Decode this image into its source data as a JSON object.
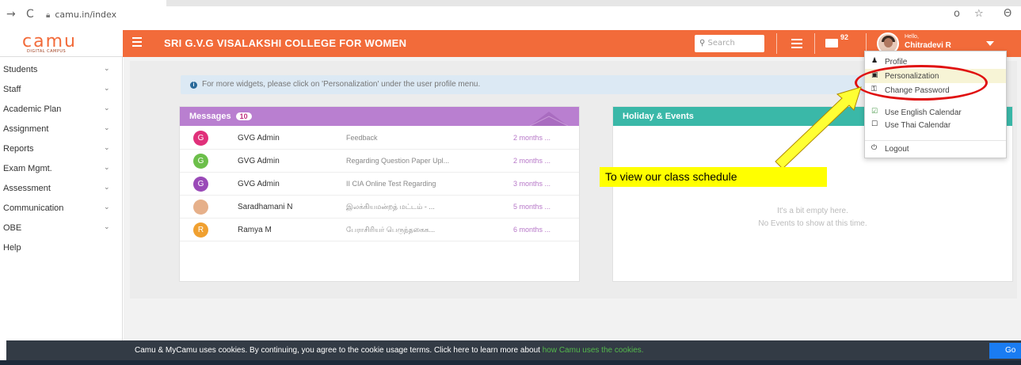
{
  "browser": {
    "back_icon": "→",
    "reload_icon": "C",
    "url": "camu.in/index",
    "key_icon": "o",
    "star_icon": "☆",
    "profile_icon": "Θ"
  },
  "logo": {
    "text": "camu",
    "subtext": "DIGITAL CAMPUS"
  },
  "header": {
    "college_name": "SRI G.V.G VISALAKSHI COLLEGE FOR WOMEN",
    "search_placeholder": "Search",
    "mail_count": "92",
    "hello": "Hello,",
    "user_name": "Chitradevi R"
  },
  "sidebar": {
    "items": [
      {
        "label": "Students",
        "chev": "⌄"
      },
      {
        "label": "Staff",
        "chev": "⌄"
      },
      {
        "label": "Academic Plan",
        "chev": "⌄"
      },
      {
        "label": "Assignment",
        "chev": "⌄"
      },
      {
        "label": "Reports",
        "chev": "⌄"
      },
      {
        "label": "Exam Mgmt.",
        "chev": "⌄"
      },
      {
        "label": "Assessment",
        "chev": "⌄"
      },
      {
        "label": "Communication",
        "chev": "⌄"
      },
      {
        "label": "OBE",
        "chev": "⌄"
      },
      {
        "label": "Help",
        "chev": ""
      }
    ]
  },
  "info": {
    "icon": "i",
    "text": "For more widgets, please click on 'Personalization' under the user profile menu."
  },
  "messages": {
    "title": "Messages",
    "badge": "10",
    "rows": [
      {
        "initial": "G",
        "color": "#e0307a",
        "sender": "GVG Admin",
        "subject": "Feedback",
        "time": "2 months ..."
      },
      {
        "initial": "G",
        "color": "#6cbf4a",
        "sender": "GVG Admin",
        "subject": "Regarding Question Paper Upl...",
        "time": "2 months ..."
      },
      {
        "initial": "G",
        "color": "#9a4ab8",
        "sender": "GVG Admin",
        "subject": "II CIA Online Test Regarding",
        "time": "3 months ..."
      },
      {
        "initial": "",
        "color": "#e6b08a",
        "sender": "Saradhamani N",
        "subject": "இலக்கியமன்றத் மட்டம் - ...",
        "time": "5 months ..."
      },
      {
        "initial": "R",
        "color": "#f0a030",
        "sender": "Ramya M",
        "subject": "பேராசிரியர் பெருந்தகைக...",
        "time": "6 months ..."
      }
    ]
  },
  "holiday": {
    "title": "Holiday & Events",
    "empty_line1": "It's a bit empty here.",
    "empty_line2": "No Events to show at this time."
  },
  "dropdown": {
    "items": [
      {
        "icon": "♟",
        "label": "Profile"
      },
      {
        "icon": "▣",
        "label": "Personalization"
      },
      {
        "icon": "⚿",
        "label": "Change Password"
      },
      {
        "icon": "☑",
        "label": "Use English Calendar"
      },
      {
        "icon": "☐",
        "label": "Use Thai Calendar"
      },
      {
        "icon": "⏻",
        "label": "Logout"
      }
    ]
  },
  "annotation": {
    "callout": "To view our class schedule"
  },
  "cookie": {
    "text": "Camu & MyCamu uses cookies. By continuing, you agree to the cookie usage terms. Click here to learn more about ",
    "link": "how Camu uses the cookies.",
    "button": "Go"
  }
}
